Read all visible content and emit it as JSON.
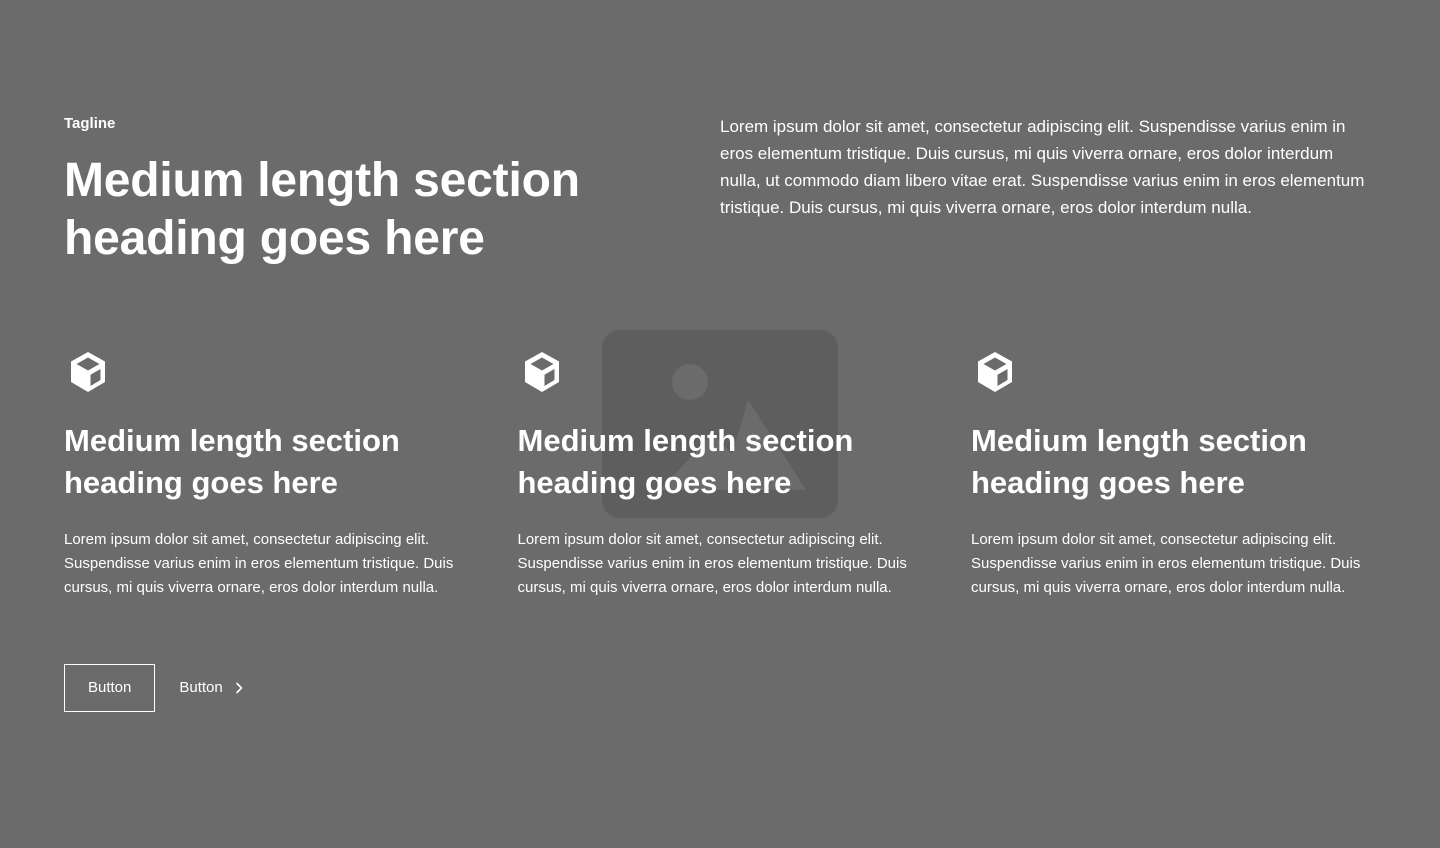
{
  "header": {
    "tagline": "Tagline",
    "heading": "Medium length section heading goes here",
    "intro": "Lorem ipsum dolor sit amet, consectetur adipiscing elit. Suspendisse varius enim in eros elementum tristique. Duis cursus, mi quis viverra ornare, eros dolor interdum nulla, ut commodo diam libero vitae erat. Suspendisse varius enim in eros elementum tristique. Duis cursus, mi quis viverra ornare, eros dolor interdum nulla."
  },
  "features": [
    {
      "icon": "cube-icon",
      "heading": "Medium length section heading goes here",
      "text": "Lorem ipsum dolor sit amet, consectetur adipiscing elit. Suspendisse varius enim in eros elementum tristique. Duis cursus, mi quis viverra ornare, eros dolor interdum nulla."
    },
    {
      "icon": "cube-icon",
      "heading": "Medium length section heading goes here",
      "text": "Lorem ipsum dolor sit amet, consectetur adipiscing elit. Suspendisse varius enim in eros elementum tristique. Duis cursus, mi quis viverra ornare, eros dolor interdum nulla."
    },
    {
      "icon": "cube-icon",
      "heading": "Medium length section heading goes here",
      "text": "Lorem ipsum dolor sit amet, consectetur adipiscing elit. Suspendisse varius enim in eros elementum tristique. Duis cursus, mi quis viverra ornare, eros dolor interdum nulla."
    }
  ],
  "actions": {
    "primary_label": "Button",
    "secondary_label": "Button",
    "secondary_icon": "chevron-right-icon"
  },
  "colors": {
    "background": "#6b6b6b",
    "text": "#ffffff",
    "placeholder": "#5e5e5e"
  }
}
